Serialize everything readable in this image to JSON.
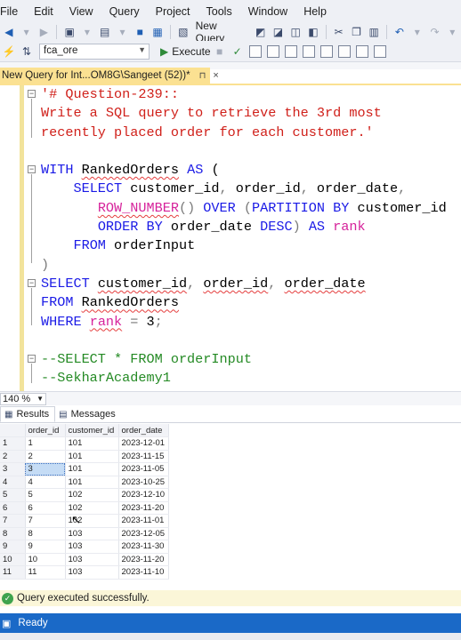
{
  "menu": [
    "File",
    "Edit",
    "View",
    "Query",
    "Project",
    "Tools",
    "Window",
    "Help"
  ],
  "toolbar": {
    "new_query_label": "New Query",
    "database": "fca_ore",
    "execute_label": "Execute"
  },
  "tab": {
    "title": "New Query for Int...OM8G\\Sangeet (52))*",
    "pin": "⊓",
    "close": "×"
  },
  "editor": {
    "lines": [
      {
        "parts": [
          {
            "t": "'# Question-239::",
            "c": "str"
          }
        ]
      },
      {
        "parts": [
          {
            "t": "Write a SQL query to retrieve the 3rd most",
            "c": "str"
          }
        ]
      },
      {
        "parts": [
          {
            "t": "recently placed order for each customer.'",
            "c": "str"
          }
        ]
      },
      {
        "parts": []
      },
      {
        "parts": [
          {
            "t": "WITH",
            "c": "kw"
          },
          {
            "t": " "
          },
          {
            "t": "RankedOrders",
            "c": "sq"
          },
          {
            "t": " "
          },
          {
            "t": "AS",
            "c": "kw"
          },
          {
            "t": " ("
          }
        ]
      },
      {
        "parts": [
          {
            "t": "    "
          },
          {
            "t": "SELECT",
            "c": "kw"
          },
          {
            "t": " customer_id"
          },
          {
            "t": ",",
            "c": "gray"
          },
          {
            "t": " order_id"
          },
          {
            "t": ",",
            "c": "gray"
          },
          {
            "t": " order_date"
          },
          {
            "t": ",",
            "c": "gray"
          }
        ]
      },
      {
        "parts": [
          {
            "t": "       "
          },
          {
            "t": "ROW_NUMBER",
            "c": "fn sq"
          },
          {
            "t": "() ",
            "c": "gray"
          },
          {
            "t": "OVER",
            "c": "kw"
          },
          {
            "t": " (",
            "c": "gray"
          },
          {
            "t": "PARTITION BY",
            "c": "kw"
          },
          {
            "t": " customer_id"
          }
        ]
      },
      {
        "parts": [
          {
            "t": "       "
          },
          {
            "t": "ORDER BY",
            "c": "kw"
          },
          {
            "t": " order_date "
          },
          {
            "t": "DESC",
            "c": "kw"
          },
          {
            "t": ") ",
            "c": "gray"
          },
          {
            "t": "AS",
            "c": "kw"
          },
          {
            "t": " "
          },
          {
            "t": "rank",
            "c": "fn"
          }
        ]
      },
      {
        "parts": [
          {
            "t": "    "
          },
          {
            "t": "FROM",
            "c": "kw"
          },
          {
            "t": " orderInput"
          }
        ]
      },
      {
        "parts": [
          {
            "t": ")",
            "c": "gray"
          }
        ]
      },
      {
        "parts": [
          {
            "t": "SELECT",
            "c": "kw"
          },
          {
            "t": " "
          },
          {
            "t": "customer_id",
            "c": "sq"
          },
          {
            "t": ",",
            "c": "gray"
          },
          {
            "t": " "
          },
          {
            "t": "order_id",
            "c": "sq"
          },
          {
            "t": ",",
            "c": "gray"
          },
          {
            "t": " "
          },
          {
            "t": "order_date",
            "c": "sq"
          }
        ]
      },
      {
        "parts": [
          {
            "t": "FROM",
            "c": "kw"
          },
          {
            "t": " "
          },
          {
            "t": "RankedOrders",
            "c": "sq"
          }
        ]
      },
      {
        "parts": [
          {
            "t": "WHERE",
            "c": "kw"
          },
          {
            "t": " "
          },
          {
            "t": "rank",
            "c": "fn sq"
          },
          {
            "t": " "
          },
          {
            "t": "=",
            "c": "gray"
          },
          {
            "t": " 3"
          },
          {
            "t": ";",
            "c": "gray"
          }
        ]
      },
      {
        "parts": []
      },
      {
        "parts": [
          {
            "t": "--SELECT * FROM orderInput",
            "c": "cmt"
          }
        ]
      },
      {
        "parts": [
          {
            "t": "--SekharAcademy1",
            "c": "cmt"
          }
        ]
      }
    ]
  },
  "zoom": "140 %",
  "results_tabs": {
    "results_label": "Results",
    "messages_label": "Messages"
  },
  "grid": {
    "columns": [
      "order_id",
      "customer_id",
      "order_date"
    ],
    "rows": [
      [
        "1",
        "1",
        "101",
        "2023-12-01"
      ],
      [
        "2",
        "2",
        "101",
        "2023-11-15"
      ],
      [
        "3",
        "3",
        "101",
        "2023-11-05"
      ],
      [
        "4",
        "4",
        "101",
        "2023-10-25"
      ],
      [
        "5",
        "5",
        "102",
        "2023-12-10"
      ],
      [
        "6",
        "6",
        "102",
        "2023-11-20"
      ],
      [
        "7",
        "7",
        "102",
        "2023-11-01"
      ],
      [
        "8",
        "8",
        "103",
        "2023-12-05"
      ],
      [
        "9",
        "9",
        "103",
        "2023-11-30"
      ],
      [
        "10",
        "10",
        "103",
        "2023-11-20"
      ],
      [
        "11",
        "11",
        "103",
        "2023-11-10"
      ]
    ],
    "selected_row_index": 2
  },
  "status": {
    "query_message": "Query executed successfully.",
    "ready": "Ready"
  }
}
